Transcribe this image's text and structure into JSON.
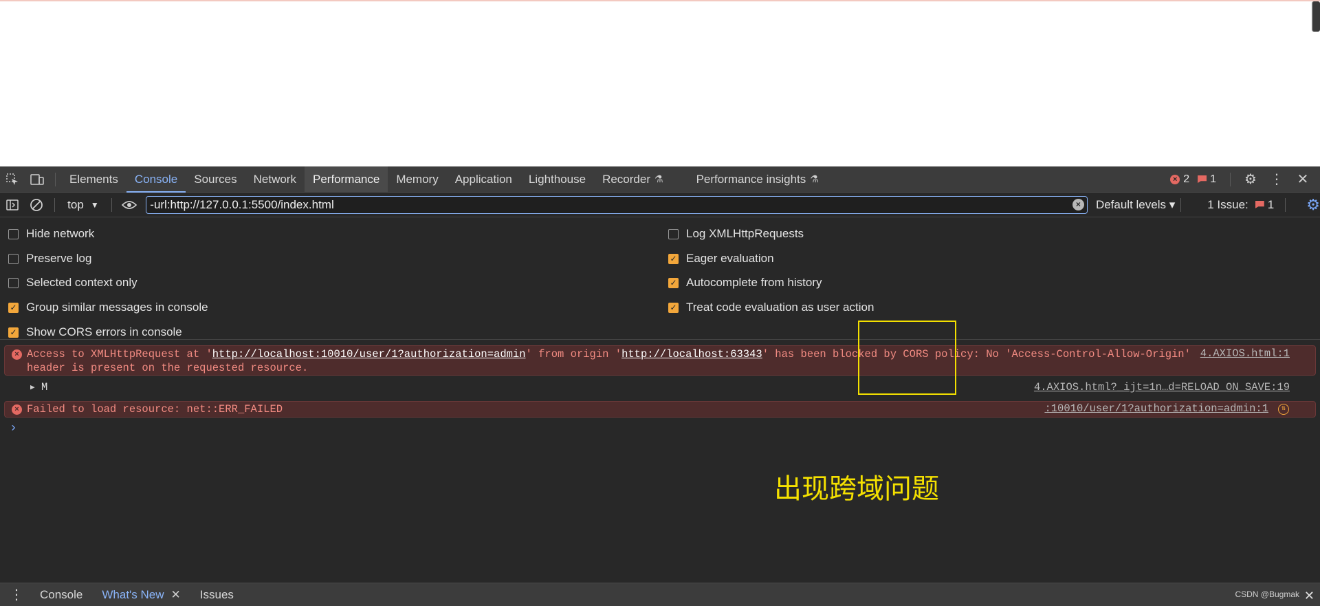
{
  "tabbar": {
    "tabs": [
      {
        "label": "Elements"
      },
      {
        "label": "Console"
      },
      {
        "label": "Sources"
      },
      {
        "label": "Network"
      },
      {
        "label": "Performance"
      },
      {
        "label": "Memory"
      },
      {
        "label": "Application"
      },
      {
        "label": "Lighthouse"
      },
      {
        "label": "Recorder"
      },
      {
        "label": "Performance insights"
      }
    ],
    "error_count": "2",
    "issue_count": "1"
  },
  "toolbar": {
    "context": "top",
    "filter_value": "-url:http://127.0.0.1:5500/index.html",
    "levels": "Default levels ▾",
    "issues_label": "1 Issue:",
    "issues_count": "1"
  },
  "settings": {
    "left": [
      {
        "label": "Hide network",
        "checked": false
      },
      {
        "label": "Preserve log",
        "checked": false
      },
      {
        "label": "Selected context only",
        "checked": false
      },
      {
        "label": "Group similar messages in console",
        "checked": true
      },
      {
        "label": "Show CORS errors in console",
        "checked": true
      }
    ],
    "right": [
      {
        "label": "Log XMLHttpRequests",
        "checked": false
      },
      {
        "label": "Eager evaluation",
        "checked": true
      },
      {
        "label": "Autocomplete from history",
        "checked": true
      },
      {
        "label": "Treat code evaluation as user action",
        "checked": true
      }
    ]
  },
  "console": {
    "msg1": {
      "part1": "Access to XMLHttpRequest at '",
      "url1": "http://localhost:10010/user/1?authorization=admin",
      "part2": "' from origin '",
      "url2": "http://localhost:63343",
      "part3": "' has been blocked by CORS policy: No 'Access-Control-Allow-Origin'",
      "line2": "header is present on the requested resource.",
      "source": "4.AXIOS.html:1"
    },
    "msg2": {
      "text": "M",
      "source": "4.AXIOS.html?_ijt=1n…d=RELOAD_ON_SAVE:19"
    },
    "msg3": {
      "text": "Failed to load resource: net::ERR_FAILED",
      "source": ":10010/user/1?authorization=admin:1"
    }
  },
  "annotation": {
    "text": "出现跨域问题"
  },
  "drawer": {
    "tabs": [
      {
        "label": "Console"
      },
      {
        "label": "What's New"
      },
      {
        "label": "Issues"
      }
    ]
  },
  "watermark": "CSDN @Bugmak",
  "colors": {
    "accent": "#8ab4f8",
    "error": "#f28b82",
    "checkbox": "#f3a73b",
    "annotation": "#f4e000"
  }
}
